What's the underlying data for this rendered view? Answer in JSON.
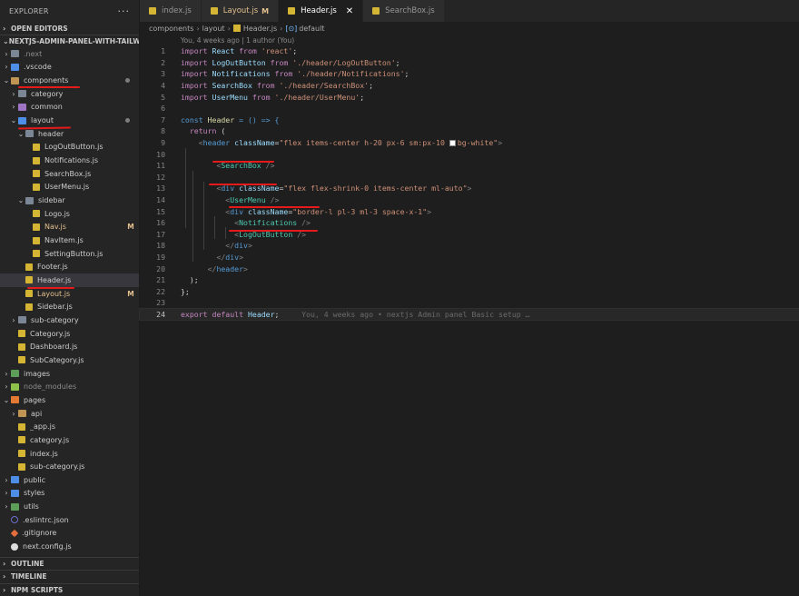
{
  "explorer": {
    "title": "EXPLORER",
    "more": "···",
    "sections": {
      "open_editors": "OPEN EDITORS",
      "project": "NEXTJS-ADMIN-PANEL-WITH-TAILWI...",
      "outline": "OUTLINE",
      "timeline": "TIMELINE",
      "npm_scripts": "NPM SCRIPTS"
    },
    "tree": [
      {
        "label": ".next",
        "chev": "›",
        "indent": 0,
        "icon": "ico-folder gray",
        "dim": true
      },
      {
        "label": ".vscode",
        "chev": "›",
        "indent": 0,
        "icon": "ico-folder blue"
      },
      {
        "label": "components",
        "chev": "⌄",
        "indent": 0,
        "icon": "ico-folder",
        "dot": true
      },
      {
        "label": "category",
        "chev": "›",
        "indent": 1,
        "icon": "ico-folder gray"
      },
      {
        "label": "common",
        "chev": "›",
        "indent": 1,
        "icon": "ico-folder purple"
      },
      {
        "label": "layout",
        "chev": "⌄",
        "indent": 1,
        "icon": "ico-folder blue",
        "dot": true
      },
      {
        "label": "header",
        "chev": "⌄",
        "indent": 2,
        "icon": "ico-folder gray"
      },
      {
        "label": "LogOutButton.js",
        "indent": 3,
        "icon": "ico-js"
      },
      {
        "label": "Notifications.js",
        "indent": 3,
        "icon": "ico-js"
      },
      {
        "label": "SearchBox.js",
        "indent": 3,
        "icon": "ico-js"
      },
      {
        "label": "UserMenu.js",
        "indent": 3,
        "icon": "ico-js"
      },
      {
        "label": "sidebar",
        "chev": "⌄",
        "indent": 2,
        "icon": "ico-folder gray"
      },
      {
        "label": "Logo.js",
        "indent": 3,
        "icon": "ico-js"
      },
      {
        "label": "Nav.js",
        "indent": 3,
        "icon": "ico-js",
        "badge": "M",
        "mod": true
      },
      {
        "label": "NavItem.js",
        "indent": 3,
        "icon": "ico-js"
      },
      {
        "label": "SettingButton.js",
        "indent": 3,
        "icon": "ico-js"
      },
      {
        "label": "Footer.js",
        "indent": 2,
        "icon": "ico-js"
      },
      {
        "label": "Header.js",
        "indent": 2,
        "icon": "ico-js",
        "active": true
      },
      {
        "label": "Layout.js",
        "indent": 2,
        "icon": "ico-js",
        "badge": "M",
        "mod": true
      },
      {
        "label": "Sidebar.js",
        "indent": 2,
        "icon": "ico-js"
      },
      {
        "label": "sub-category",
        "chev": "›",
        "indent": 1,
        "icon": "ico-folder gray"
      },
      {
        "label": "Category.js",
        "indent": 1,
        "icon": "ico-js"
      },
      {
        "label": "Dashboard.js",
        "indent": 1,
        "icon": "ico-js"
      },
      {
        "label": "SubCategory.js",
        "indent": 1,
        "icon": "ico-js"
      },
      {
        "label": "images",
        "chev": "›",
        "indent": 0,
        "icon": "ico-folder green"
      },
      {
        "label": "node_modules",
        "chev": "›",
        "indent": 0,
        "icon": "ico-folder lgreen",
        "dim": true
      },
      {
        "label": "pages",
        "chev": "⌄",
        "indent": 0,
        "icon": "ico-folder orange"
      },
      {
        "label": "api",
        "chev": "›",
        "indent": 1,
        "icon": "ico-folder"
      },
      {
        "label": "_app.js",
        "indent": 1,
        "icon": "ico-js"
      },
      {
        "label": "category.js",
        "indent": 1,
        "icon": "ico-js"
      },
      {
        "label": "index.js",
        "indent": 1,
        "icon": "ico-js"
      },
      {
        "label": "sub-category.js",
        "indent": 1,
        "icon": "ico-js"
      },
      {
        "label": "public",
        "chev": "›",
        "indent": 0,
        "icon": "ico-folder blue"
      },
      {
        "label": "styles",
        "chev": "›",
        "indent": 0,
        "icon": "ico-folder blue"
      },
      {
        "label": "utils",
        "chev": "›",
        "indent": 0,
        "icon": "ico-folder green"
      },
      {
        "label": ".eslintrc.json",
        "indent": 0,
        "icon": "ico-json"
      },
      {
        "label": ".gitignore",
        "indent": 0,
        "icon": "ico-git"
      },
      {
        "label": "next.config.js",
        "indent": 0,
        "icon": "ico-next"
      }
    ]
  },
  "tabs": [
    {
      "label": "index.js",
      "active": false
    },
    {
      "label": "Layout.js",
      "active": false,
      "modified": "M"
    },
    {
      "label": "Header.js",
      "active": true,
      "close": "✕"
    },
    {
      "label": "SearchBox.js",
      "active": false
    }
  ],
  "breadcrumb": {
    "parts": [
      "components",
      "layout",
      "Header.js"
    ],
    "symbol": "default",
    "symbol_icon": "[⊙]"
  },
  "blame": "You, 4 weeks ago | 1 author (You)",
  "code": {
    "line_numbers": [
      "1",
      "2",
      "3",
      "4",
      "5",
      "6",
      "7",
      "8",
      "9",
      "10",
      "11",
      "12",
      "13",
      "14",
      "15",
      "16",
      "17",
      "18",
      "19",
      "20",
      "21",
      "22",
      "23",
      "24"
    ],
    "current_line": 24,
    "inline_blame": "You, 4 weeks ago • nextjs Admin panel Basic setup …",
    "l1": {
      "kw": "import",
      "id": "React",
      "from": "from",
      "path": "'react'",
      "end": ";"
    },
    "l2": {
      "kw": "import",
      "id": "LogOutButton",
      "from": "from",
      "path": "'./header/LogOutButton'",
      "end": ";"
    },
    "l3": {
      "kw": "import",
      "id": "Notifications",
      "from": "from",
      "path": "'./header/Notifications'",
      "end": ";"
    },
    "l4": {
      "kw": "import",
      "id": "SearchBox",
      "from": "from",
      "path": "'./header/SearchBox'",
      "end": ";"
    },
    "l5": {
      "kw": "import",
      "id": "UserMenu",
      "from": "from",
      "path": "'./header/UserMenu'",
      "end": ";"
    },
    "l7": {
      "kw": "const",
      "name": "Header",
      "rest": " = () => {"
    },
    "l8": {
      "kw": "return",
      "rest": " ("
    },
    "l9": {
      "open": "<",
      "tag": "header",
      "attr": "className",
      "eq": "=",
      "val1": "\"flex items-center h-20 px-6 sm:px-10 ",
      "val2": "bg-white\"",
      "close": ">"
    },
    "l11": {
      "open": "<",
      "tag": "SearchBox",
      "close": " />"
    },
    "l13": {
      "open": "<",
      "tag": "div",
      "attr": "className",
      "eq": "=",
      "val": "\"flex flex-shrink-0 items-center ml-auto\"",
      "close": ">"
    },
    "l14": {
      "open": "<",
      "tag": "UserMenu",
      "close": " />"
    },
    "l15": {
      "open": "<",
      "tag": "div",
      "attr": "className",
      "eq": "=",
      "val": "\"border-l pl-3 ml-3 space-x-1\"",
      "close": ">"
    },
    "l16": {
      "open": "<",
      "tag": "Notifications",
      "close": " />"
    },
    "l17": {
      "open": "<",
      "tag": "LogOutButton",
      "close": " />"
    },
    "l18": {
      "open": "</",
      "tag": "div",
      "close": ">"
    },
    "l19": {
      "open": "</",
      "tag": "div",
      "close": ">"
    },
    "l20": {
      "open": "</",
      "tag": "header",
      "close": ">"
    },
    "l21": {
      "text": ");"
    },
    "l22": {
      "text": "};"
    },
    "l24": {
      "kw": "export",
      "kw2": "default",
      "id": "Header",
      "end": ";"
    }
  },
  "colors": {
    "annotation": "#e51a1a",
    "modified": "#e2c08d",
    "keyword": "#c586c0",
    "string": "#ce9178",
    "component": "#4ec9b0"
  }
}
